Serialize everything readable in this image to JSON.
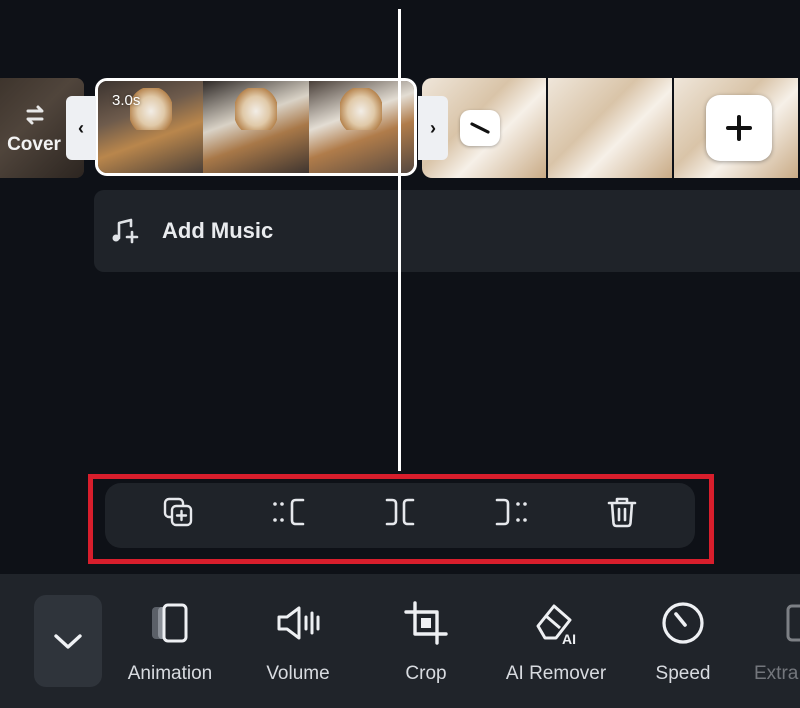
{
  "timeline": {
    "cover_label": "Cover",
    "selected_clip_duration": "3.0s",
    "trim_left_glyph": "‹",
    "trim_right_glyph": "›",
    "add_music_label": "Add Music"
  },
  "edit_toolbar": {
    "tools": [
      {
        "name": "duplicate-icon"
      },
      {
        "name": "split-left-icon"
      },
      {
        "name": "split-icon"
      },
      {
        "name": "split-right-icon"
      },
      {
        "name": "delete-icon"
      }
    ]
  },
  "bottom_bar": {
    "collapse_icon": "chevron-down-icon",
    "items": [
      {
        "label": "Animation",
        "icon": "animation-icon"
      },
      {
        "label": "Volume",
        "icon": "volume-icon"
      },
      {
        "label": "Crop",
        "icon": "crop-icon"
      },
      {
        "label": "AI Remover",
        "icon": "ai-eraser-icon"
      },
      {
        "label": "Speed",
        "icon": "speed-icon"
      },
      {
        "label": "Extra",
        "icon": "extra-icon"
      }
    ]
  },
  "colors": {
    "background": "#0e1117",
    "panel": "#1f2329",
    "highlight_border": "#d81e2c",
    "playhead": "#ffffff"
  }
}
